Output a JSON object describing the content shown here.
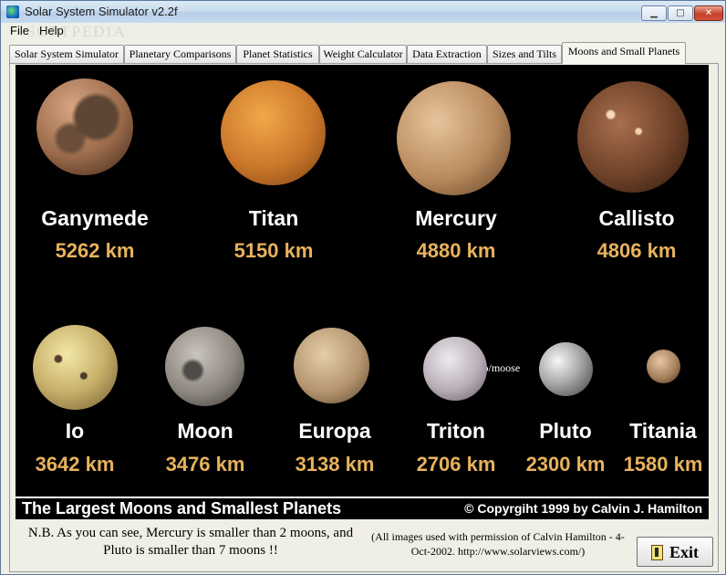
{
  "window": {
    "title": "Solar System Simulator v2.2f",
    "watermark": "SOFTPEDIA"
  },
  "menu": {
    "file": "File",
    "help": "Help"
  },
  "tabs": [
    "Solar System Simulator",
    "Planetary Comparisons",
    "Planet Statistics",
    "Weight Calculator",
    "Data Extraction",
    "Sizes and Tilts",
    "Moons and Small Planets"
  ],
  "active_tab": "Moons and Small Planets",
  "bodies_row1": [
    {
      "name": "Ganymede",
      "diameter": "5262 km"
    },
    {
      "name": "Titan",
      "diameter": "5150 km"
    },
    {
      "name": "Mercury",
      "diameter": "4880 km"
    },
    {
      "name": "Callisto",
      "diameter": "4806 km"
    }
  ],
  "bodies_row2": [
    {
      "name": "Io",
      "diameter": "3642 km"
    },
    {
      "name": "Moon",
      "diameter": "3476 km"
    },
    {
      "name": "Europa",
      "diameter": "3138 km"
    },
    {
      "name": "Triton",
      "diameter": "2706 km"
    },
    {
      "name": "Pluto",
      "diameter": "2300 km"
    },
    {
      "name": "Titania",
      "diameter": "1580 km"
    }
  ],
  "url": "http://move.to/moose",
  "footer": {
    "title": "The Largest Moons and Smallest Planets",
    "copyright": "© Copyrgiht 1999 by Calvin J. Hamilton"
  },
  "note": "N.B.  As you can see, Mercury is smaller than 2 moons, and Pluto is smaller than 7 moons !!",
  "credit": "(All images used with permission of Calvin Hamilton - 4-Oct-2002.  http://www.solarviews.com/)",
  "exit_button": {
    "label": "Exit"
  },
  "colors": {
    "background": "#000000",
    "name_text": "#ffffff",
    "diameter_text": "#e8b25c"
  }
}
